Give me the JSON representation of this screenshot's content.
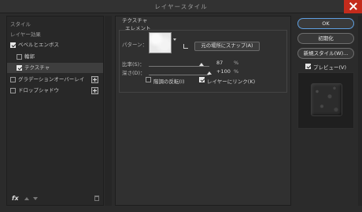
{
  "window": {
    "title": "レイヤースタイル"
  },
  "left_panel": {
    "style_header": "スタイル",
    "effects_header": "レイヤー効果",
    "items": [
      {
        "label": "ベベルとエンボス",
        "checked": true,
        "selected": false
      },
      {
        "label": "輪郭",
        "checked": false,
        "selected": false
      },
      {
        "label": "テクスチャ",
        "checked": true,
        "selected": true
      },
      {
        "label": "グラデーションオーバーレイ",
        "checked": false,
        "selected": false,
        "has_add": true
      },
      {
        "label": "ドロップシャドウ",
        "checked": false,
        "selected": false,
        "has_add": true
      }
    ],
    "footer": {
      "fx_label": "fx"
    }
  },
  "texture_panel": {
    "group_title": "テクスチャ",
    "section_title": "エレメント",
    "pattern_label": "パターン：",
    "snap_button": "元の場所にスナップ(A)",
    "scale": {
      "label": "比率(S)：",
      "value": "87",
      "unit": "%",
      "level": 0.87
    },
    "depth": {
      "label": "深さ(D)：",
      "value": "+100",
      "unit": "%",
      "level": 1.0
    },
    "invert": {
      "label": "階調の反転(I)",
      "checked": false
    },
    "link": {
      "label": "レイヤーにリンク(K)",
      "checked": true
    }
  },
  "right_panel": {
    "ok_button": "OK",
    "reset_button": "初期化",
    "new_style_button": "新規スタイル(W)...",
    "preview": {
      "label": "プレビュー(V)",
      "checked": true
    }
  },
  "colors": {
    "accent": "#5f9fe0",
    "close": "#c42b1c",
    "background": "#2b2b2b"
  }
}
